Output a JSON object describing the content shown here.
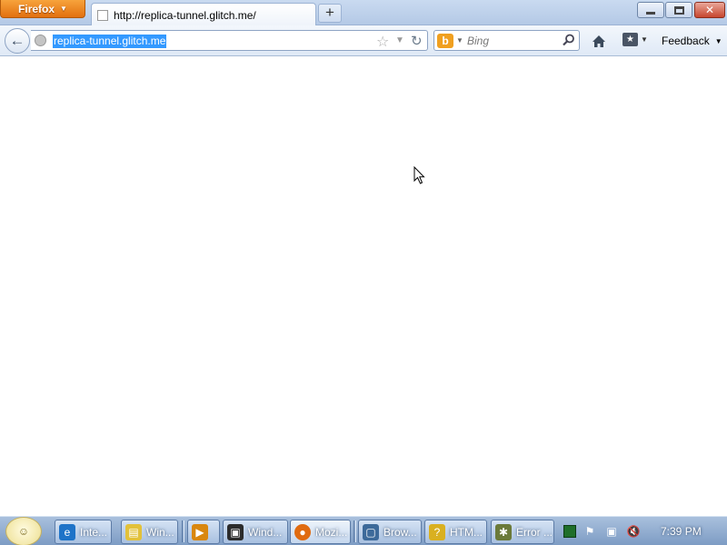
{
  "browser": {
    "menu_label": "Firefox",
    "tab": {
      "title": "http://replica-tunnel.glitch.me/"
    },
    "new_tab_label": "+",
    "window_controls": {
      "minimize": "minimize-icon",
      "maximize": "maximize-icon",
      "close": "close-icon"
    }
  },
  "navbar": {
    "url": "replica-tunnel.glitch.me",
    "search_placeholder": "Bing",
    "search_engine_icon": "bing-icon",
    "feedback_label": "Feedback"
  },
  "taskbar": {
    "items": [
      {
        "label": "Inte...",
        "icon": "internet-explorer-icon",
        "color": "#1e73c8"
      },
      {
        "label": "Win...",
        "icon": "folder-icon",
        "color": "#e2c13a"
      },
      {
        "label": "",
        "icon": "media-player-icon",
        "color": "#d9870f"
      },
      {
        "label": "Wind...",
        "icon": "terminal-icon",
        "color": "#2c2c2c"
      },
      {
        "label": "Mozi...",
        "icon": "firefox-icon",
        "color": "#e06b10"
      },
      {
        "label": "Brow...",
        "icon": "browser-window-icon",
        "color": "#3d6a9a"
      },
      {
        "label": "HTM...",
        "icon": "help-icon",
        "color": "#d9b020"
      },
      {
        "label": "Error ...",
        "icon": "error-icon",
        "color": "#6b7a3a"
      }
    ],
    "clock": "7:39 PM"
  }
}
